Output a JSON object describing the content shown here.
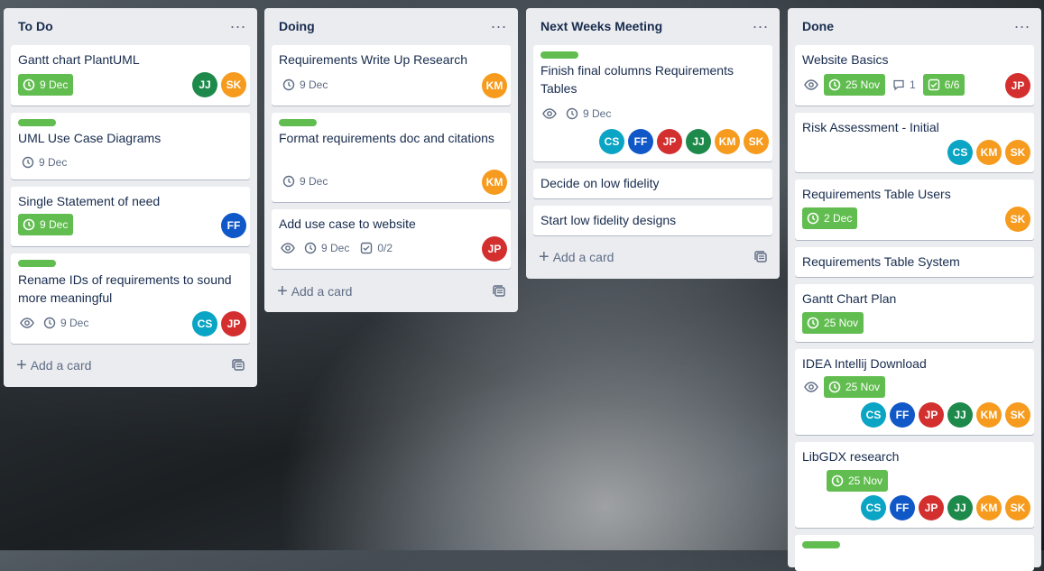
{
  "avatar_colors": {
    "JJ": "#1d8a4b",
    "SK": "#f69b1e",
    "KM": "#f69b1e",
    "FF": "#1058c8",
    "CS": "#0aa4c4",
    "JP": "#d32f2f"
  },
  "add_card_label": "Add a card",
  "lists": [
    {
      "title": "To Do",
      "cards": [
        {
          "title": "Gantt chart PlantUML",
          "date": "9 Dec",
          "members": [
            "JJ",
            "SK"
          ]
        },
        {
          "title": "UML Use Case Diagrams",
          "date": "9 Dec"
        },
        {
          "title": "Single Statement of need",
          "date": "9 Dec",
          "members": [
            "FF"
          ]
        },
        {
          "title": "Rename IDs of requirements to sound more meaningful",
          "date": "9 Dec",
          "members": [
            "CS",
            "JP"
          ]
        }
      ]
    },
    {
      "title": "Doing",
      "cards": [
        {
          "title": "Requirements Write Up Research",
          "date": "9 Dec",
          "members": [
            "KM"
          ]
        },
        {
          "title": "Format requirements doc and citations",
          "date": "9 Dec",
          "members": [
            "KM"
          ]
        },
        {
          "title": "Add use case to website",
          "date": "9 Dec",
          "checklist": "0/2",
          "members": [
            "JP"
          ]
        }
      ]
    },
    {
      "title": "Next Weeks Meeting",
      "cards": [
        {
          "title": "Finish final columns Requirements Tables",
          "date": "9 Dec",
          "members": [
            "CS",
            "FF",
            "JP",
            "JJ",
            "KM",
            "SK"
          ]
        },
        {
          "title": "Decide on low fidelity"
        },
        {
          "title": "Start low fidelity designs"
        }
      ]
    },
    {
      "title": "Done",
      "cards": [
        {
          "title": "Website Basics",
          "date": "25 Nov",
          "comments": "1",
          "checklist": "6/6",
          "members": [
            "JP"
          ]
        },
        {
          "title": "Risk Assessment - Initial",
          "members": [
            "CS",
            "KM",
            "SK"
          ]
        },
        {
          "title": "Requirements Table Users",
          "date": "2 Dec",
          "members": [
            "SK"
          ]
        },
        {
          "title": "Requirements Table System"
        },
        {
          "title": "Gantt Chart Plan",
          "date": "25 Nov"
        },
        {
          "title": "IDEA Intellij Download",
          "date": "25 Nov",
          "members": [
            "CS",
            "FF",
            "JP",
            "JJ",
            "KM",
            "SK"
          ]
        },
        {
          "title": "LibGDX research",
          "date": "25 Nov",
          "members": [
            "CS",
            "FF",
            "JP",
            "JJ",
            "KM",
            "SK"
          ]
        }
      ]
    }
  ]
}
